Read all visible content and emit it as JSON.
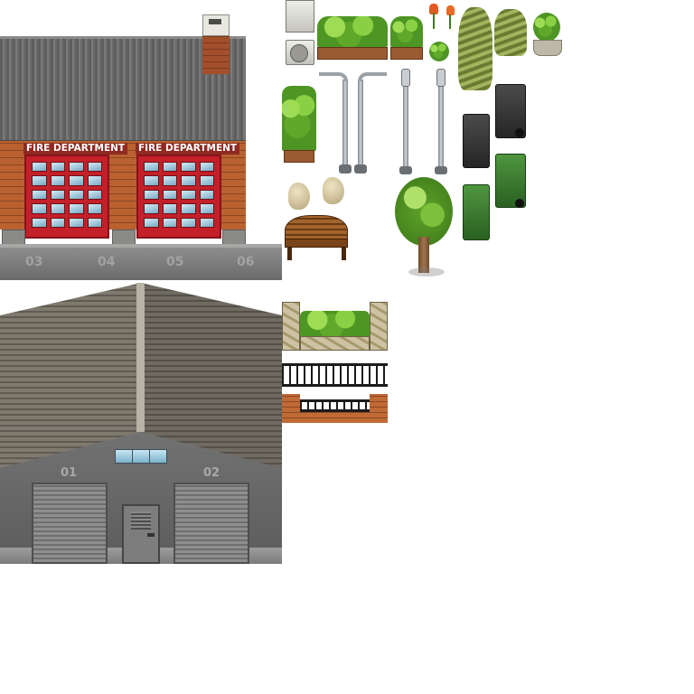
{
  "tileset": {
    "fire_station": {
      "sign_left": "FIRE DEPARTMENT",
      "sign_right": "FIRE DEPARTMENT",
      "lot_numbers": [
        "03",
        "04",
        "05",
        "06"
      ]
    },
    "warehouse": {
      "bay_numbers": [
        "01",
        "02"
      ]
    }
  },
  "colors": {
    "fire_door": "#c3202a",
    "brick": "#b9622f",
    "roof": "#6a6a6a",
    "foliage": "#4e9623",
    "bin_green": "#2a6021",
    "bin_black": "#262626"
  }
}
